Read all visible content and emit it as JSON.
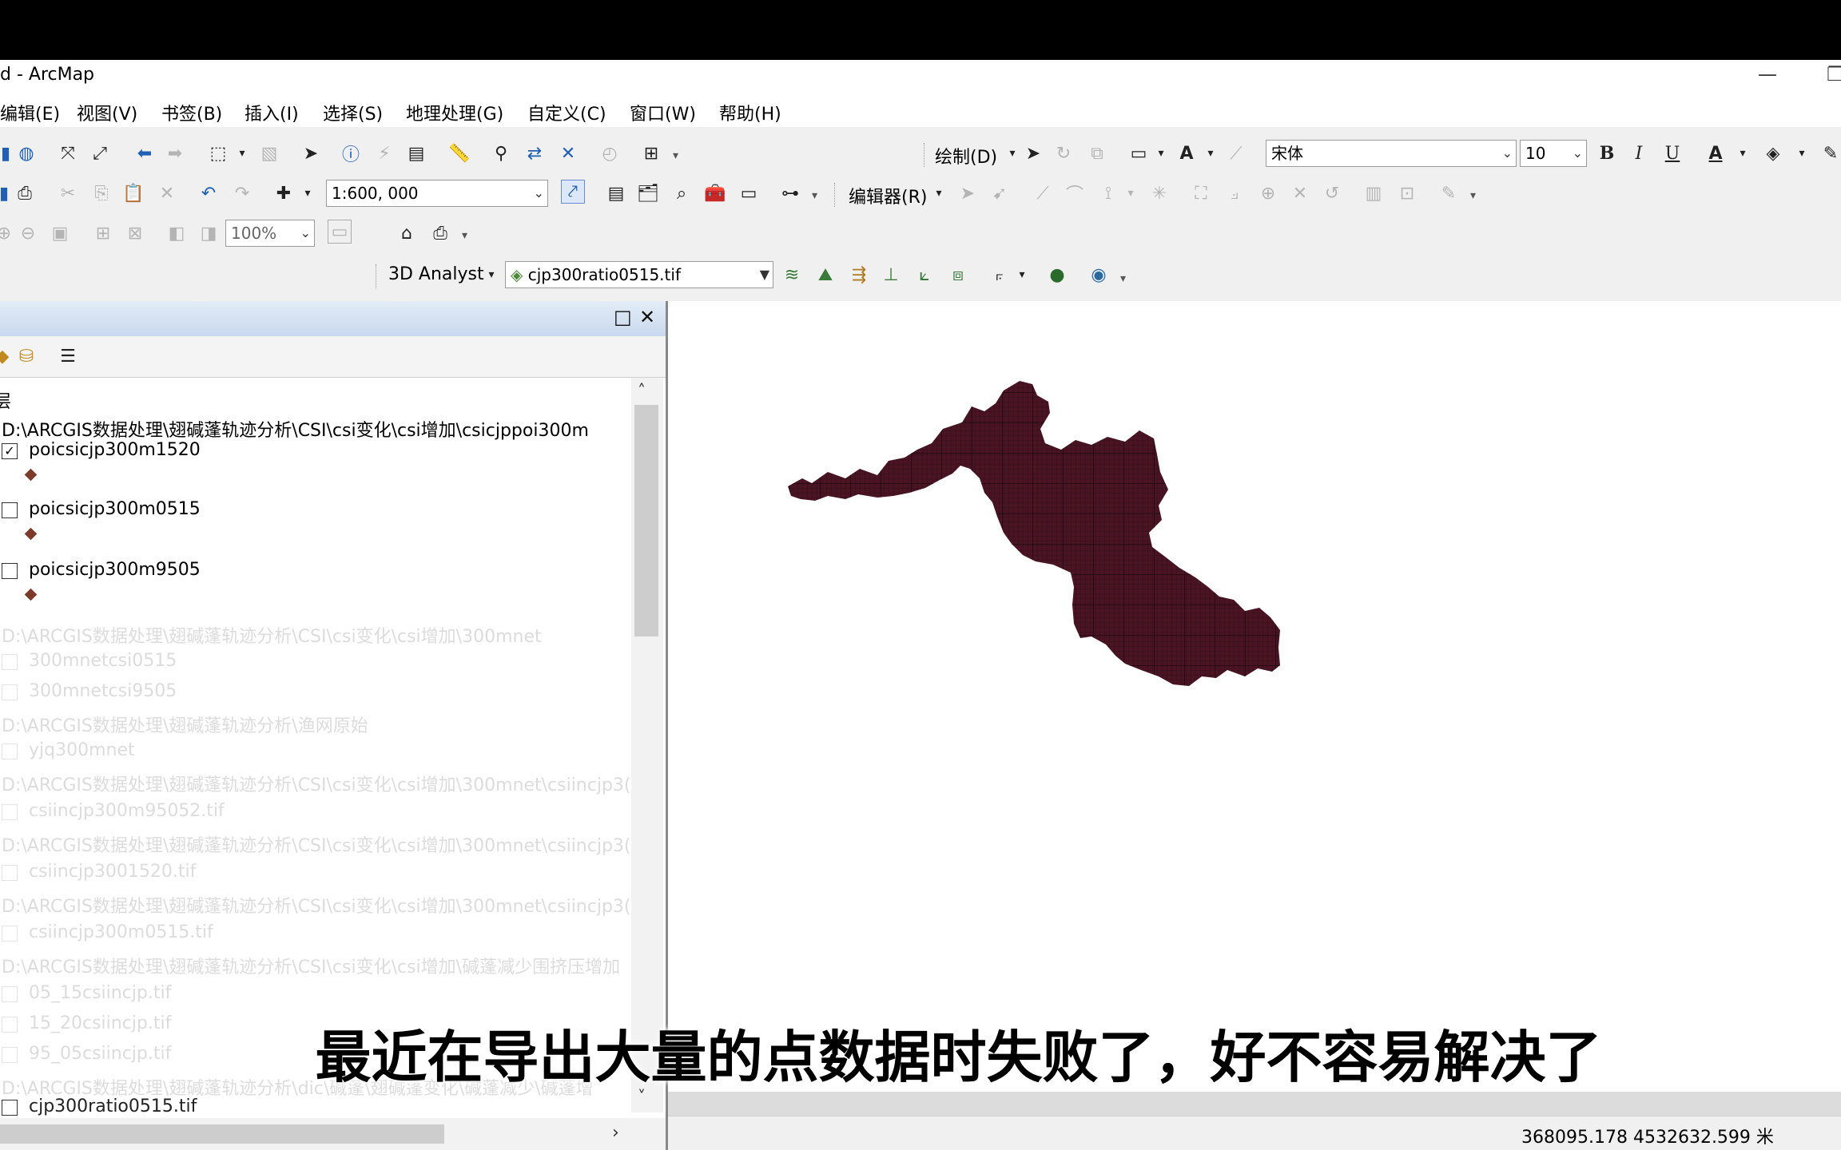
{
  "window": {
    "title": "d - ArcMap",
    "minimize": "—",
    "maximize": "❐"
  },
  "menu": [
    "编辑(E)",
    "视图(V)",
    "书签(B)",
    "插入(I)",
    "选择(S)",
    "地理处理(G)",
    "自定义(C)",
    "窗口(W)",
    "帮助(H)"
  ],
  "toolbar_draw": {
    "label": "绘制(D)",
    "font": "宋体",
    "font_size": "10",
    "bold": "B",
    "italic": "I",
    "underline": "U",
    "font_color": "A"
  },
  "toolbar_standard": {
    "scale": "1:600, 000",
    "editor": "编辑器(R)"
  },
  "toolbar_layout": {
    "zoom": "100%"
  },
  "toolbar_3d": {
    "label": "3D Analyst",
    "layer": "cjp300ratio0515.tif"
  },
  "toc": {
    "header_buttons": {
      "float": "□",
      "close": "✕"
    },
    "root_label": "层",
    "group_path": "D:\\ARCGIS数据处理\\翅碱蓬轨迹分析\\CSI\\csi变化\\csi增加\\csicjppoi300m",
    "layers": [
      {
        "name": "poicsicjp300m1520",
        "checked": true
      },
      {
        "name": "poicsicjp300m0515",
        "checked": false
      },
      {
        "name": "poicsicjp300m9505",
        "checked": false
      }
    ],
    "faded_rows": [
      {
        "text": "D:\\ARCGIS数据处理\\翅碱蓬轨迹分析\\CSI\\csi变化\\csi增加\\300mnet",
        "type": "path"
      },
      {
        "text": "300mnetcsi0515",
        "type": "layer"
      },
      {
        "text": "300mnetcsi9505",
        "type": "layer"
      },
      {
        "text": "D:\\ARCGIS数据处理\\翅碱蓬轨迹分析\\渔网原始",
        "type": "path"
      },
      {
        "text": "yjq300mnet",
        "type": "layer"
      },
      {
        "text": "D:\\ARCGIS数据处理\\翅碱蓬轨迹分析\\CSI\\csi变化\\csi增加\\300mnet\\csiincjp3(",
        "type": "path"
      },
      {
        "text": "csiincjp300m95052.tif",
        "type": "layer"
      },
      {
        "text": "D:\\ARCGIS数据处理\\翅碱蓬轨迹分析\\CSI\\csi变化\\csi增加\\300mnet\\csiincjp3(",
        "type": "path"
      },
      {
        "text": "csiincjp3001520.tif",
        "type": "layer"
      },
      {
        "text": "D:\\ARCGIS数据处理\\翅碱蓬轨迹分析\\CSI\\csi变化\\csi增加\\300mnet\\csiincjp3(",
        "type": "path"
      },
      {
        "text": "csiincjp300m0515.tif",
        "type": "layer"
      },
      {
        "text": "D:\\ARCGIS数据处理\\翅碱蓬轨迹分析\\CSI\\csi变化\\csi增加\\碱蓬减少围挤压增加",
        "type": "path"
      },
      {
        "text": "05_15csiincjp.tif",
        "type": "layer"
      },
      {
        "text": "15_20csiincjp.tif",
        "type": "layer"
      },
      {
        "text": "95_05csiincjp.tif",
        "type": "layer"
      },
      {
        "text": "D:\\ARCGIS数据处理\\翅碱蓬轨迹分析\\dic\\碱蓬\\翅碱蓬变化\\碱蓬减少\\碱蓬增",
        "type": "path"
      },
      {
        "text": "cjp300ratio0515.tif",
        "type": "layer"
      }
    ]
  },
  "status": {
    "coords": "368095.178  4532632.599 米"
  },
  "subtitle": "最近在导出大量的点数据时失败了，好不容易解决了",
  "colors": {
    "raster_fill": "#4a1422",
    "raster_grid": "#2a0a12",
    "marker": "#7b3a2a"
  }
}
